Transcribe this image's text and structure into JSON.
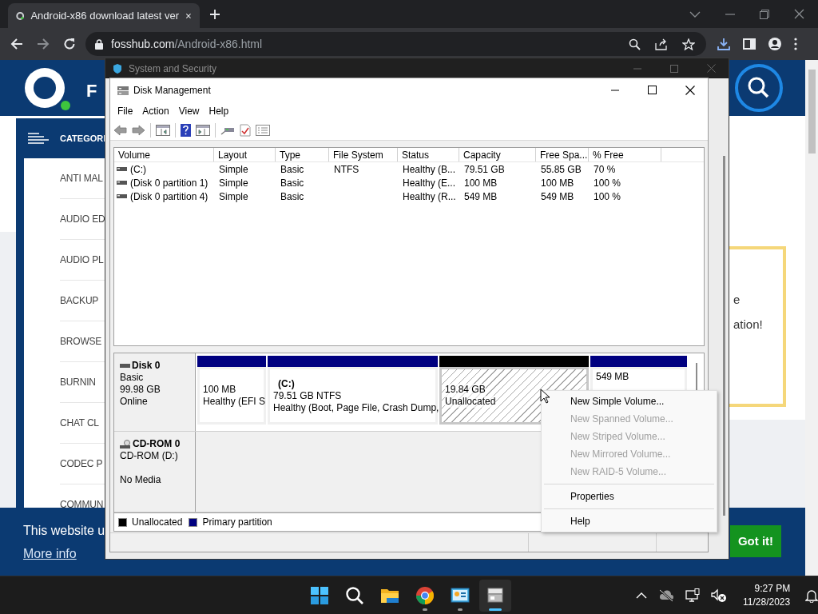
{
  "browser": {
    "tabs": [
      {
        "title": "Android-x86 download latest ver",
        "selected": true
      }
    ],
    "address": {
      "host": "fosshub.com",
      "path": "/Android-x86.html"
    }
  },
  "website": {
    "logo_text": "F",
    "categories_title": "CATEGORI",
    "categories": [
      "ANTI MAL",
      "AUDIO ED",
      "AUDIO PL",
      "BACKUP",
      "BROWSE",
      "BURNIN",
      "CHAT CL",
      "CODEC P",
      "COMMUN"
    ],
    "promo_lines": [
      "e",
      "ation!"
    ],
    "cookie_banner": {
      "text": "This website u",
      "link": "More info",
      "button": "Got it!"
    }
  },
  "system_window": {
    "title": "System and Security"
  },
  "disk_management": {
    "title": "Disk Management",
    "menu": [
      "File",
      "Action",
      "View",
      "Help"
    ],
    "volume_table": {
      "columns": [
        "Volume",
        "Layout",
        "Type",
        "File System",
        "Status",
        "Capacity",
        "Free Spa...",
        "% Free"
      ],
      "rows": [
        {
          "cells": [
            "(C:)",
            "Simple",
            "Basic",
            "NTFS",
            "Healthy (B...",
            "79.51 GB",
            "55.85 GB",
            "70 %"
          ]
        },
        {
          "cells": [
            "(Disk 0 partition 1)",
            "Simple",
            "Basic",
            "",
            "Healthy (E...",
            "100 MB",
            "100 MB",
            "100 %"
          ]
        },
        {
          "cells": [
            "(Disk 0 partition 4)",
            "Simple",
            "Basic",
            "",
            "Healthy (R...",
            "549 MB",
            "549 MB",
            "100 %"
          ]
        }
      ]
    },
    "disks": [
      {
        "kind": "disk",
        "name": "Disk 0",
        "type": "Basic",
        "size": "99.98 GB",
        "state": "Online",
        "partitions": [
          {
            "kind": "primary",
            "size": "100 MB",
            "status": "Healthy (EFI S"
          },
          {
            "kind": "primary",
            "label": "(C:)",
            "size": "79.51 GB NTFS",
            "status": "Healthy (Boot, Page File, Crash Dump,"
          },
          {
            "kind": "unallocated",
            "size": "19.84 GB",
            "status": "Unallocated",
            "selected": true
          },
          {
            "kind": "primary",
            "size": "549 MB"
          }
        ]
      },
      {
        "kind": "cdrom",
        "name": "CD-ROM 0",
        "drive": "CD-ROM (D:)",
        "media": "No Media"
      }
    ],
    "legend": [
      {
        "label": "Unallocated",
        "color": "#000000"
      },
      {
        "label": "Primary partition",
        "color": "#000080"
      }
    ]
  },
  "context_menu": [
    {
      "kind": "item",
      "label": "New Simple Volume...",
      "disabled": false
    },
    {
      "kind": "item",
      "label": "New Spanned Volume...",
      "disabled": true
    },
    {
      "kind": "item",
      "label": "New Striped Volume...",
      "disabled": true
    },
    {
      "kind": "item",
      "label": "New Mirrored Volume...",
      "disabled": true
    },
    {
      "kind": "item",
      "label": "New RAID-5 Volume...",
      "disabled": true
    },
    {
      "kind": "separator"
    },
    {
      "kind": "item",
      "label": "Properties",
      "disabled": false
    },
    {
      "kind": "separator"
    },
    {
      "kind": "item",
      "label": "Help",
      "disabled": false
    }
  ],
  "taskbar": {
    "apps": [
      {
        "kind": "start",
        "running": false,
        "selected": false
      },
      {
        "kind": "search",
        "running": false,
        "selected": false
      },
      {
        "kind": "explorer",
        "running": false,
        "selected": false
      },
      {
        "kind": "chrome",
        "running": true,
        "selected": false
      },
      {
        "kind": "control",
        "running": true,
        "selected": false
      },
      {
        "kind": "diskmgmt",
        "running": true,
        "selected": true
      }
    ],
    "time": "9:27 PM",
    "date": "11/28/2023"
  }
}
